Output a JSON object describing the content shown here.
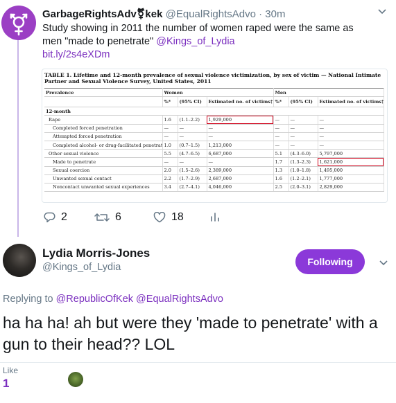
{
  "tweet1": {
    "display_name": "GarbageRightsAdv⚧kek",
    "handle": "@EqualRightsAdvo",
    "separator": "·",
    "time": "30m",
    "text_main": "Study showing in 2011 the number of women raped were the same as men \"made to penetrate\"",
    "mention": "@Kings_of_Lydia",
    "link": "bit.ly/2s4eXDm",
    "media": {
      "title": "TABLE 1. Lifetime and 12-month prevalence of sexual violence victimization, by sex of victim — National Intimate Partner and Sexual Violence Survey, United States, 2011",
      "headers": {
        "prevalence": "Prevalence",
        "women": "Women",
        "men": "Men",
        "pct": "%*",
        "ci": "(95% CI)",
        "est": "Estimated no. of victims†"
      },
      "section": "12-month",
      "rows": [
        {
          "label": "Rape",
          "w_pct": "1.6",
          "w_ci": "(1.1–2.2)",
          "w_est": "1,929,000",
          "m_pct": "—",
          "m_ci": "—",
          "m_est": "—",
          "indent": 1
        },
        {
          "label": "Completed forced penetration",
          "w_pct": "—",
          "w_ci": "—",
          "w_est": "—",
          "m_pct": "—",
          "m_ci": "—",
          "m_est": "—",
          "indent": 2
        },
        {
          "label": "Attempted forced penetration",
          "w_pct": "—",
          "w_ci": "—",
          "w_est": "—",
          "m_pct": "—",
          "m_ci": "—",
          "m_est": "—",
          "indent": 2
        },
        {
          "label": "Completed alcohol- or drug-facilitated penetration",
          "w_pct": "1.0",
          "w_ci": "(0.7–1.5)",
          "w_est": "1,213,000",
          "m_pct": "—",
          "m_ci": "—",
          "m_est": "—",
          "indent": 2
        },
        {
          "label": "Other sexual violence",
          "w_pct": "5.5",
          "w_ci": "(4.7–6.5)",
          "w_est": "6,687,000",
          "m_pct": "5.1",
          "m_ci": "(4.3–6.0)",
          "m_est": "5,797,000",
          "indent": 1
        },
        {
          "label": "Made to penetrate",
          "w_pct": "—",
          "w_ci": "—",
          "w_est": "—",
          "m_pct": "1.7",
          "m_ci": "(1.3–2.3)",
          "m_est": "1,621,000",
          "indent": 2
        },
        {
          "label": "Sexual coercion",
          "w_pct": "2.0",
          "w_ci": "(1.5–2.6)",
          "w_est": "2,389,000",
          "m_pct": "1.3",
          "m_ci": "(1.0–1.8)",
          "m_est": "1,495,000",
          "indent": 2
        },
        {
          "label": "Unwanted sexual contact",
          "w_pct": "2.2",
          "w_ci": "(1.7–2.9)",
          "w_est": "2,687,000",
          "m_pct": "1.6",
          "m_ci": "(1.2–2.1)",
          "m_est": "1,777,000",
          "indent": 2
        },
        {
          "label": "Noncontact unwanted sexual experiences",
          "w_pct": "3.4",
          "w_ci": "(2.7–4.1)",
          "w_est": "4,046,000",
          "m_pct": "2.5",
          "m_ci": "(2.0–3.1)",
          "m_est": "2,829,000",
          "indent": 2
        }
      ]
    },
    "actions": {
      "replies": "2",
      "retweets": "6",
      "likes": "18"
    }
  },
  "tweet2": {
    "display_name": "Lydia Morris-Jones",
    "handle": "@Kings_of_Lydia",
    "follow_label": "Following",
    "replying_prefix": "Replying to",
    "replying_to_1": "@RepublicOfKek",
    "replying_to_2": "@EqualRightsAdvo",
    "text": "ha ha ha! ah but were they 'made to penetrate' with a gun to their head?? LOL",
    "like_label": "Like",
    "like_count": "1"
  },
  "colors": {
    "accent": "#7b2fbf",
    "button": "#8b39d9",
    "muted": "#657786",
    "highlight_box": "#d0021b"
  },
  "icons": [
    "avatar-icon",
    "caret-down-icon",
    "reply-icon",
    "retweet-icon",
    "heart-icon",
    "analytics-icon"
  ]
}
